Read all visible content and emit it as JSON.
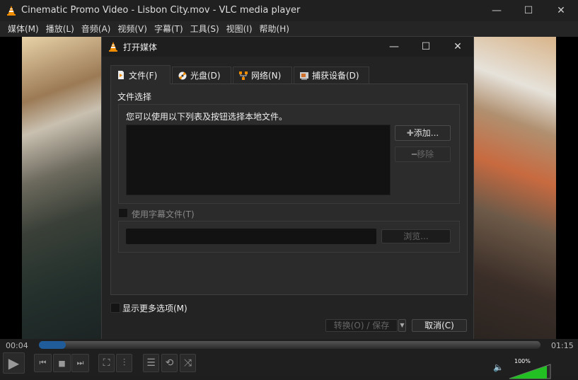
{
  "window": {
    "title": "Cinematic Promo Video - Lisbon City.mov - VLC media player",
    "minimize": "—",
    "maximize": "☐",
    "close": "✕"
  },
  "menu": [
    "媒体(M)",
    "播放(L)",
    "音频(A)",
    "视频(V)",
    "字幕(T)",
    "工具(S)",
    "视图(I)",
    "帮助(H)"
  ],
  "dialog": {
    "title": "打开媒体",
    "tabs": [
      {
        "label": "文件(F)",
        "icon": "file-icon"
      },
      {
        "label": "光盘(D)",
        "icon": "disc-icon"
      },
      {
        "label": "网络(N)",
        "icon": "network-icon"
      },
      {
        "label": "捕获设备(D)",
        "icon": "capture-device-icon"
      }
    ],
    "file_section_title": "文件选择",
    "file_hint": "您可以使用以下列表及按钮选择本地文件。",
    "add_button": "添加...",
    "remove_button": "移除",
    "subtitle_checkbox": "使用字幕文件(T)",
    "browse_button": "浏览...",
    "more_options": "显示更多选项(M)",
    "convert_button": "转换(O) / 保存",
    "cancel_button": "取消(C)"
  },
  "player": {
    "elapsed": "00:04",
    "total": "01:15",
    "progress_percent": 5.3,
    "volume_label": "100%",
    "volume_percent": 100,
    "accent": "#1f5c99"
  }
}
